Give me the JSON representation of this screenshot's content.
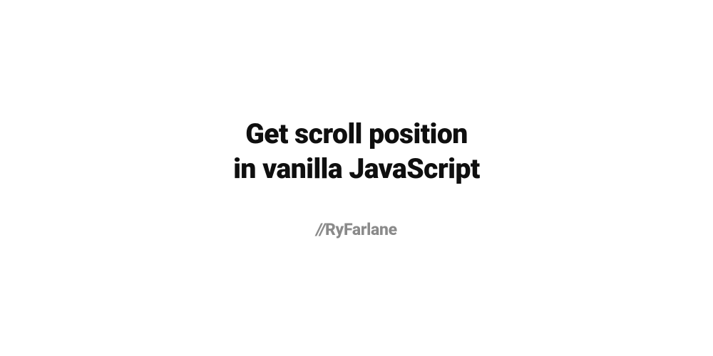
{
  "title": {
    "line1": "Get scroll position",
    "line2": "in vanilla JavaScript"
  },
  "byline": {
    "prefix": "//",
    "name": "RyFarlane"
  }
}
